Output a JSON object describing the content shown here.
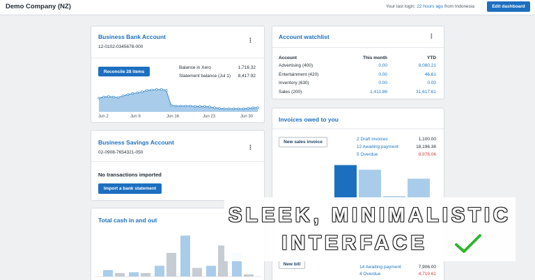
{
  "header": {
    "org_name": "Demo Company (NZ)",
    "login_prefix": "Your last login:",
    "login_time": "22 hours ago",
    "login_suffix": "from Indonesia",
    "edit_button": "Edit dashboard"
  },
  "bank_account": {
    "title": "Business Bank Account",
    "number": "12-0102-0345678-000",
    "reconcile_button": "Reconcile 28 items",
    "balance_xero_label": "Balance in Xero",
    "balance_xero_value": "1,716.32",
    "statement_label": "Statement balance (Jul 1)",
    "statement_value": "8,417.92",
    "chart_data": {
      "type": "area",
      "x_labels": [
        "Jun 2",
        "Jun 9",
        "Jun 16",
        "Jun 23",
        "Jun 30"
      ],
      "values": [
        0.55,
        0.6,
        0.62,
        0.6,
        0.58,
        0.65,
        0.7,
        0.75,
        0.78,
        0.82,
        0.88,
        0.9,
        0.92,
        0.92,
        0.88,
        0.25,
        0.22,
        0.22,
        0.22,
        0.22,
        0.2,
        0.2,
        0.2,
        0.18,
        0.15,
        0.12,
        0.1,
        0.1,
        0.1,
        0.1,
        0.1,
        0.12,
        0.14,
        0.15
      ],
      "color": "#a9ccea",
      "line_color": "#1c77c3"
    }
  },
  "savings_account": {
    "title": "Business Savings Account",
    "number": "02-0908-7654321-050",
    "no_transactions": "No transactions imported",
    "import_button": "Import a bank statement"
  },
  "cash": {
    "title": "Total cash in and out",
    "chart_data": {
      "type": "bar",
      "series": [
        {
          "values": [
            0.15,
            0.1,
            0.25,
            0.95,
            0.25,
            0.55
          ],
          "color": "#a9ccea"
        },
        {
          "values": [
            0.08,
            0.08,
            0.55,
            0.2,
            0.72,
            0.05
          ],
          "color": "#c7ccd2"
        }
      ]
    }
  },
  "watchlist": {
    "title": "Account watchlist",
    "headers": [
      "Account",
      "This month",
      "YTD"
    ],
    "rows": [
      {
        "account": "Advertising (400)",
        "month": "0.00",
        "ytd": "9,080.21"
      },
      {
        "account": "Entertainment (420)",
        "month": "0.00",
        "ytd": "46.61"
      },
      {
        "account": "Inventory (630)",
        "month": "0.00",
        "ytd": "0.00"
      },
      {
        "account": "Sales (200)",
        "month": "1,411.86",
        "ytd": "31,617.61"
      }
    ]
  },
  "invoices": {
    "title": "Invoices owed to you",
    "new_invoice_button": "New sales invoice",
    "summary": [
      {
        "label": "2 Draft invoices",
        "value": "1,100.00",
        "value_color": "dark"
      },
      {
        "label": "12 Awaiting payment",
        "value": "18,196.38",
        "value_color": "dark"
      },
      {
        "label": "5 Overdue",
        "value": "8,978.06",
        "value_color": "red"
      }
    ],
    "chart_data": {
      "type": "bar",
      "values": [
        0.9,
        0.78,
        0.1,
        0.55
      ],
      "colors": [
        "#1c6fbf",
        "#a9ccea",
        "#a9ccea",
        "#a9ccea"
      ]
    },
    "new_bill_button": "New bill",
    "bills_summary": [
      {
        "label": "14 Awaiting payment",
        "value": "7,906.00",
        "value_color": "dark"
      },
      {
        "label": "4 Overdue",
        "value": "4,719.61",
        "value_color": "red"
      }
    ]
  },
  "overlay": {
    "line1": "SLEEK, MINIMALISTIC",
    "line2": "INTERFACE",
    "check_color": "#2fb52c"
  }
}
